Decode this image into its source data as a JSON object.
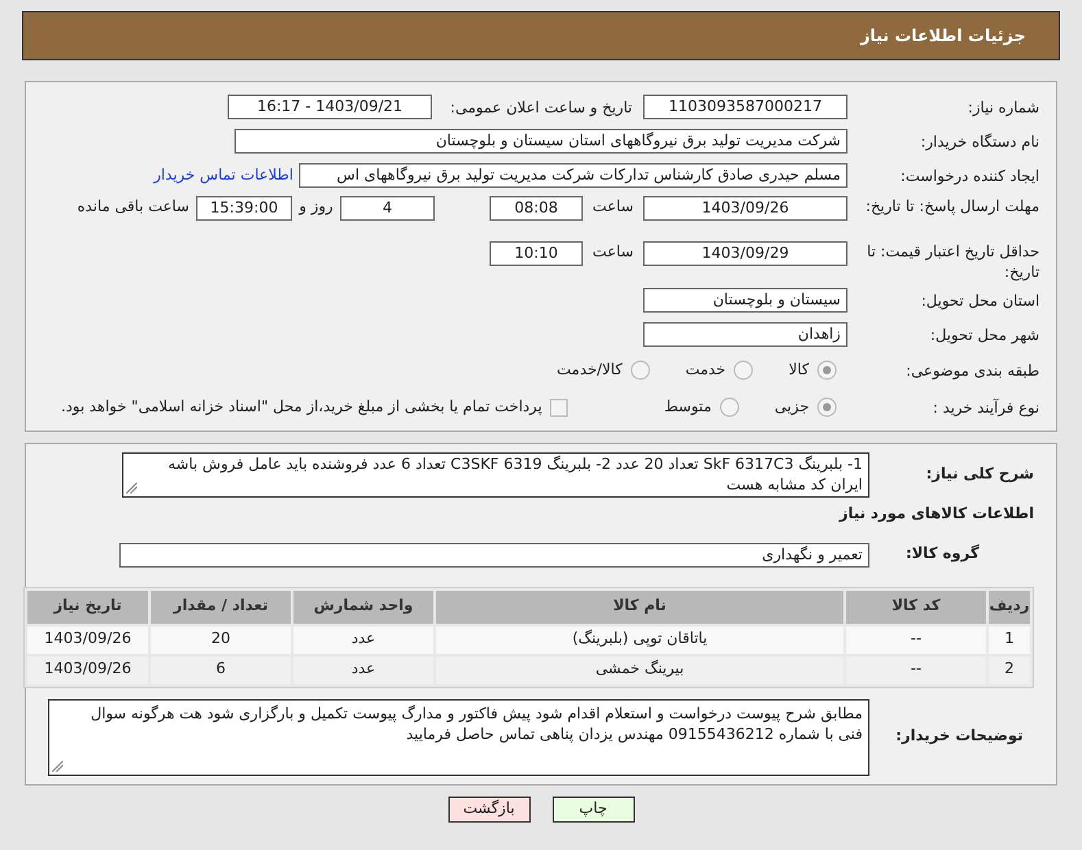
{
  "page_title": "جزئیات اطلاعات نیاز",
  "need_number": {
    "label": "شماره نیاز:",
    "value": "1103093587000217"
  },
  "announce": {
    "label": "تاریخ و ساعت اعلان عمومی:",
    "value": "1403/09/21 - 16:17"
  },
  "buyer_org": {
    "label": "نام دستگاه خریدار:",
    "value": "شرکت مدیریت تولید برق نیروگاههای استان سیستان و بلوچستان"
  },
  "requester": {
    "label": "ایجاد کننده درخواست:",
    "value": "مسلم حیدری صادق کارشناس تدارکات شرکت مدیریت تولید برق نیروگاههای اس",
    "link": "اطلاعات تماس خریدار"
  },
  "response_deadline": {
    "label": "مهلت ارسال پاسخ: تا تاریخ:",
    "date": "1403/09/26",
    "time_label": "ساعت",
    "time": "08:08",
    "days": "4",
    "days_label": "روز و",
    "remaining": "15:39:00",
    "remaining_label": "ساعت باقی مانده"
  },
  "price_validity": {
    "label": "حداقل تاریخ اعتبار قیمت: تا تاریخ:",
    "date": "1403/09/29",
    "time_label": "ساعت",
    "time": "10:10"
  },
  "province": {
    "label": "استان محل تحویل:",
    "value": "سیستان و بلوچستان"
  },
  "city": {
    "label": "شهر محل تحویل:",
    "value": "زاهدان"
  },
  "category": {
    "label": "طبقه بندی موضوعی:",
    "options": [
      {
        "label": "کالا",
        "selected": true
      },
      {
        "label": "خدمت",
        "selected": false
      },
      {
        "label": "کالا/خدمت",
        "selected": false
      }
    ]
  },
  "purchase_type": {
    "label": "نوع فرآیند خرید :",
    "options": [
      {
        "label": "جزیی",
        "selected": true
      },
      {
        "label": "متوسط",
        "selected": false
      }
    ],
    "payment": {
      "label": "پرداخت تمام یا بخشی از مبلغ خرید،از محل \"اسناد خزانه اسلامی\" خواهد بود.",
      "checked": false
    }
  },
  "description": {
    "label": "شرح کلی نیاز:",
    "value": "1- بلبرینگ SkF   6317C3    تعداد  20 عدد  2- بلبرینگ      6319     C3SKF       تعداد 6 عدد فروشنده باید عامل فروش باشه ایران کد مشابه هست"
  },
  "goods_title": "اطلاعات کالاهای مورد نیاز",
  "goods_group": {
    "label": "گروه کالا:",
    "value": "تعمیر و نگهداری"
  },
  "table": {
    "columns": [
      "ردیف",
      "کد کالا",
      "نام کالا",
      "واحد شمارش",
      "تعداد / مقدار",
      "تاریخ نیاز"
    ],
    "rows": [
      [
        "1",
        "--",
        "یاتاقان توپی (بلبرینگ)",
        "عدد",
        "20",
        "1403/09/26"
      ],
      [
        "2",
        "--",
        "بیرینگ خمشی",
        "عدد",
        "6",
        "1403/09/26"
      ]
    ]
  },
  "buyer_notes": {
    "label": "توضیحات خریدار:",
    "value": "مطابق شرح  پیوست درخواست و استعلام اقدام شود پیش فاکتور   و مدارگ پیوست تکمیل و بارگزاری شود  هت هرگونه سوال فنی با شماره 09155436212 مهندس یزدان پناهی تماس حاصل فرمایید"
  },
  "buttons": [
    {
      "label": "چاپ",
      "kind": "print"
    },
    {
      "label": "بازگشت",
      "kind": "back"
    }
  ]
}
